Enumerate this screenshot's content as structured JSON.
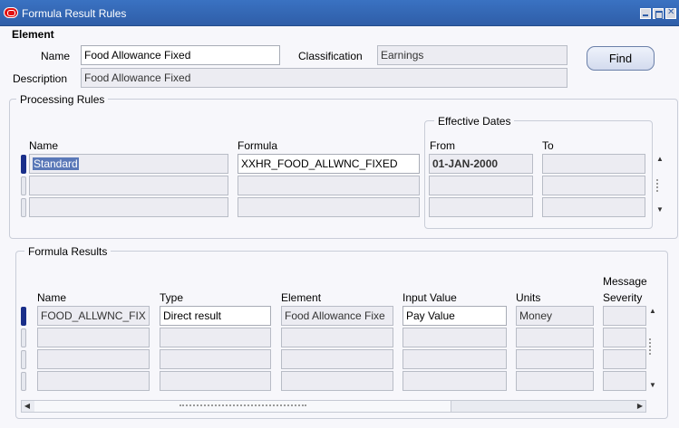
{
  "window": {
    "title": "Formula Result Rules"
  },
  "element": {
    "heading": "Element",
    "name_label": "Name",
    "name_value": "Food Allowance Fixed",
    "classification_label": "Classification",
    "classification_value": "Earnings",
    "description_label": "Description",
    "description_value": "Food Allowance Fixed",
    "find_label": "Find"
  },
  "processing_rules": {
    "title": "Processing Rules",
    "effective_dates_title": "Effective Dates",
    "headers": {
      "name": "Name",
      "formula": "Formula",
      "from": "From",
      "to": "To"
    },
    "rows": [
      {
        "name": "Standard",
        "formula": "XXHR_FOOD_ALLWNC_FIXED",
        "from": "01-JAN-2000",
        "to": ""
      },
      {
        "name": "",
        "formula": "",
        "from": "",
        "to": ""
      },
      {
        "name": "",
        "formula": "",
        "from": "",
        "to": ""
      }
    ]
  },
  "formula_results": {
    "title": "Formula Results",
    "headers": {
      "name": "Name",
      "type": "Type",
      "element": "Element",
      "input_value": "Input Value",
      "units": "Units",
      "message_severity_1": "Message",
      "message_severity_2": "Severity"
    },
    "rows": [
      {
        "name": "FOOD_ALLWNC_FIX",
        "type": "Direct result",
        "element": "Food Allowance Fixe",
        "input_value": "Pay Value",
        "units": "Money",
        "severity": ""
      },
      {
        "name": "",
        "type": "",
        "element": "",
        "input_value": "",
        "units": "",
        "severity": ""
      },
      {
        "name": "",
        "type": "",
        "element": "",
        "input_value": "",
        "units": "",
        "severity": ""
      },
      {
        "name": "",
        "type": "",
        "element": "",
        "input_value": "",
        "units": "",
        "severity": ""
      }
    ]
  },
  "icons": [
    "oracle-forms-icon",
    "minimize-icon",
    "maximize-icon",
    "close-icon",
    "scroll-up-icon",
    "scroll-down-icon",
    "scroll-left-icon",
    "scroll-right-icon"
  ],
  "colors": {
    "titlebar": "#2f5ea8",
    "selected_text_bg": "#5a78b8",
    "active_row_indicator": "#1a2f8a"
  }
}
